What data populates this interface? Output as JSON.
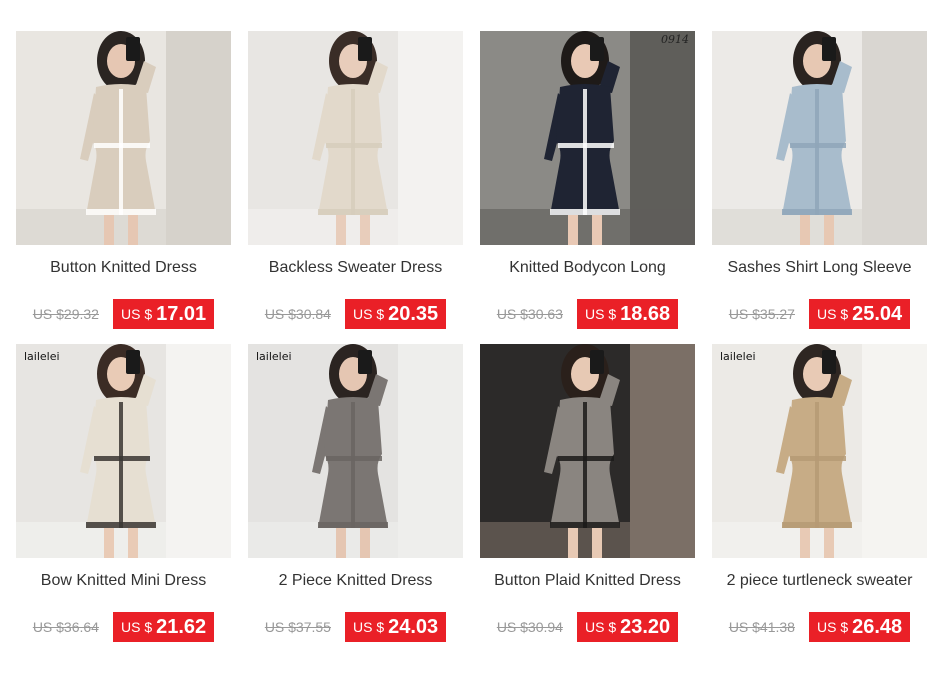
{
  "products": [
    {
      "title": "Button Knitted Dress",
      "old_price": "US $29.32",
      "currency": "US $",
      "price": "17.01",
      "brand": "",
      "code": "",
      "colors": {
        "bg": "#e9e6e1",
        "bg2": "#d6d2cb",
        "dress": "#d9cdbd",
        "trim": "#ffffff",
        "hair": "#2b2522",
        "skin": "#e6c7b3"
      }
    },
    {
      "title": "Backless Sweater Dress",
      "old_price": "US $30.84",
      "currency": "US $",
      "price": "20.35",
      "brand": "",
      "code": "",
      "colors": {
        "bg": "#e8e6e3",
        "bg2": "#f3f2f0",
        "dress": "#e2d9cb",
        "trim": "#d6ccbc",
        "hair": "#3a2d27",
        "skin": "#e8cdbb"
      }
    },
    {
      "title": "Knitted Bodycon Long",
      "old_price": "US $30.63",
      "currency": "US $",
      "price": "18.68",
      "brand": "",
      "code": "0914",
      "colors": {
        "bg": "#8b8a86",
        "bg2": "#5f5e5a",
        "dress": "#1f2433",
        "trim": "#ffffff",
        "hair": "#1e1a18",
        "skin": "#e9c9b5"
      }
    },
    {
      "title": "Sashes Shirt Long Sleeve",
      "old_price": "US $35.27",
      "currency": "US $",
      "price": "25.04",
      "brand": "",
      "code": "",
      "colors": {
        "bg": "#eceae7",
        "bg2": "#d9d6d1",
        "dress": "#a8bccc",
        "trim": "#8fa6b8",
        "hair": "#2a2320",
        "skin": "#e7c8b3"
      }
    },
    {
      "title": "Bow Knitted Mini Dress",
      "old_price": "US $36.64",
      "currency": "US $",
      "price": "21.62",
      "brand": "lailelei",
      "code": "",
      "colors": {
        "bg": "#e7e5e2",
        "bg2": "#f4f3f1",
        "dress": "#e6dfd2",
        "trim": "#3a3633",
        "hair": "#3b2c25",
        "skin": "#e9cbb6"
      }
    },
    {
      "title": "2 Piece Knitted Dress",
      "old_price": "US $37.55",
      "currency": "US $",
      "price": "24.03",
      "brand": "lailelei",
      "code": "",
      "colors": {
        "bg": "#e4e3e1",
        "bg2": "#eeeeec",
        "dress": "#7b7673",
        "trim": "#6a6562",
        "hair": "#2b2421",
        "skin": "#e5c6b2"
      }
    },
    {
      "title": "Button Plaid Knitted Dress",
      "old_price": "US $30.94",
      "currency": "US $",
      "price": "23.20",
      "brand": "",
      "code": "",
      "colors": {
        "bg": "#2c2a29",
        "bg2": "#7b6f66",
        "dress": "#8a8580",
        "trim": "#1b1a19",
        "hair": "#2a201b",
        "skin": "#e7c9b4"
      }
    },
    {
      "title": "2 piece turtleneck sweater",
      "old_price": "US $41.38",
      "currency": "US $",
      "price": "26.48",
      "brand": "lailelei",
      "code": "",
      "colors": {
        "bg": "#eceae6",
        "bg2": "#f5f4f1",
        "dress": "#c7ac86",
        "trim": "#b59a74",
        "hair": "#2e2622",
        "skin": "#e8cab5"
      }
    }
  ]
}
